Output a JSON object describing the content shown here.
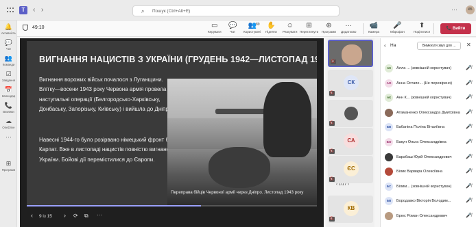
{
  "titlebar": {
    "search_icon": "search-icon",
    "search_placeholder": "Пошук (Ctrl+Alt+E)",
    "more": "···",
    "user_initials": "КБ"
  },
  "rail": [
    {
      "icon": "bell-icon",
      "glyph": "🔔",
      "label": "Активність"
    },
    {
      "icon": "chat-icon",
      "glyph": "💬",
      "label": "Чат"
    },
    {
      "icon": "teams-icon",
      "glyph": "👥",
      "label": "Команди"
    },
    {
      "icon": "tasks-icon",
      "glyph": "☑",
      "label": "Завдання"
    },
    {
      "icon": "calendar-icon",
      "glyph": "📅",
      "label": "Календар"
    },
    {
      "icon": "calls-icon",
      "glyph": "📞",
      "label": "Виклики"
    },
    {
      "icon": "onedrive-icon",
      "glyph": "☁",
      "label": "OneDrive"
    },
    {
      "icon": "more-icon",
      "glyph": "···",
      "label": ""
    },
    {
      "icon": "apps-icon",
      "glyph": "⊞",
      "label": "Програми"
    }
  ],
  "meeting": {
    "timer": "49:10",
    "participants_count": "89",
    "tools": [
      {
        "name": "camera-people-icon",
        "glyph": "▭",
        "label": "Керувати"
      },
      {
        "name": "chat-icon",
        "glyph": "💬",
        "label": "Чат"
      },
      {
        "name": "people-icon",
        "glyph": "👥",
        "label": "Користувачі"
      },
      {
        "name": "hand-icon",
        "glyph": "✋",
        "label": "Підняти"
      },
      {
        "name": "react-icon",
        "glyph": "☺",
        "label": "Реагувати"
      },
      {
        "name": "view-icon",
        "glyph": "⊞",
        "label": "Переглянути"
      },
      {
        "name": "apps-icon",
        "glyph": "⊕",
        "label": "Програми"
      },
      {
        "name": "more-icon",
        "glyph": "···",
        "label": "Додатково"
      },
      {
        "name": "camera-icon",
        "glyph": "📹",
        "label": "Камера"
      },
      {
        "name": "mic-icon",
        "glyph": "🎤",
        "label": "Мікрофон"
      },
      {
        "name": "share-icon",
        "glyph": "⬆",
        "label": "Поділитися"
      }
    ],
    "leave_label": "Вийти"
  },
  "slide": {
    "title": "ВИГНАННЯ НАЦИСТІВ З УКРАЇНИ (ГРУДЕНЬ 1942—ЛИСТОПАД 1944 РОКУ)",
    "para1": "Вигнання ворожих військ почалося з Луганщини. Влітку—восени 1943 року Червона армія провела наступальні операції (Белгородсько-Харківську, Донбаську, Запорізьку, Київську) і вийшла до Дніпра.",
    "para2": "Навесні 1944-го було розірвано німецький фронт біля Карпат. Вже в листопаді нацистів повністю вигнано з України. Бойові дії перемістилися до Європи.",
    "caption": "Переправа бійців Червоної армії через Дніпро. Листопад 1943 року",
    "page_indicator": "9 із 15",
    "progress": 0.6
  },
  "gallery": {
    "tiles": [
      {
        "type": "video",
        "initials": ""
      },
      {
        "type": "avatar",
        "initials": "СК",
        "bg": "#dfe6f7",
        "fg": "#3b5ba9"
      },
      {
        "type": "photo",
        "initials": ""
      },
      {
        "type": "avatar",
        "initials": "СА",
        "bg": "#f7dede",
        "fg": "#b03030"
      },
      {
        "type": "avatar",
        "initials": "ЄС",
        "bg": "#fbefd6",
        "fg": "#a06a00"
      },
      {
        "type": "avatar",
        "initials": "КВ",
        "bg": "#fbefd6",
        "fg": "#a06a00"
      }
    ],
    "pager": "1/17"
  },
  "panel": {
    "title": "На",
    "mute_all": "Вимкнути звук для ...",
    "people": [
      {
        "initials": "АК",
        "name": "Алла ... (зовнішній користувач)",
        "bg": "#e1ecd8",
        "fg": "#3d6b2a"
      },
      {
        "initials": "АО",
        "name": "Анна Остапе... (Не перевірено)",
        "bg": "#f3dde9",
        "fg": "#9b2d6b"
      },
      {
        "initials": "АК",
        "name": "Анн К... (зовнішній користувач)",
        "bg": "#e1ecd8",
        "fg": "#3d6b2a"
      },
      {
        "initials": "",
        "name": "Атаманенко Олександра Дмитрівна",
        "bg": "#8a6a5a",
        "fg": "#fff"
      },
      {
        "initials": "БВ",
        "name": "Бабаніна Поліна Віталіївна",
        "bg": "#dce4f7",
        "fg": "#3b5ba9"
      },
      {
        "initials": "БО",
        "name": "Бакун Ольга Олександрівна",
        "bg": "#f3dde9",
        "fg": "#9b2d6b"
      },
      {
        "initials": "",
        "name": "Барабаш Юрій Олександрович",
        "bg": "#3a3a3a",
        "fg": "#fff"
      },
      {
        "initials": "",
        "name": "Білик Варвара Олексіївна",
        "bg": "#b44a3a",
        "fg": "#fff"
      },
      {
        "initials": "БС",
        "name": "Білим... (зовнішній користувач)",
        "bg": "#dce4f7",
        "fg": "#3b5ba9"
      },
      {
        "initials": "БВ",
        "name": "Бородавко Вікторія Володим...",
        "bg": "#dce4f7",
        "fg": "#3b5ba9"
      },
      {
        "initials": "",
        "name": "Брюс Роман Олександрович",
        "bg": "#b89a80",
        "fg": "#fff"
      }
    ]
  }
}
